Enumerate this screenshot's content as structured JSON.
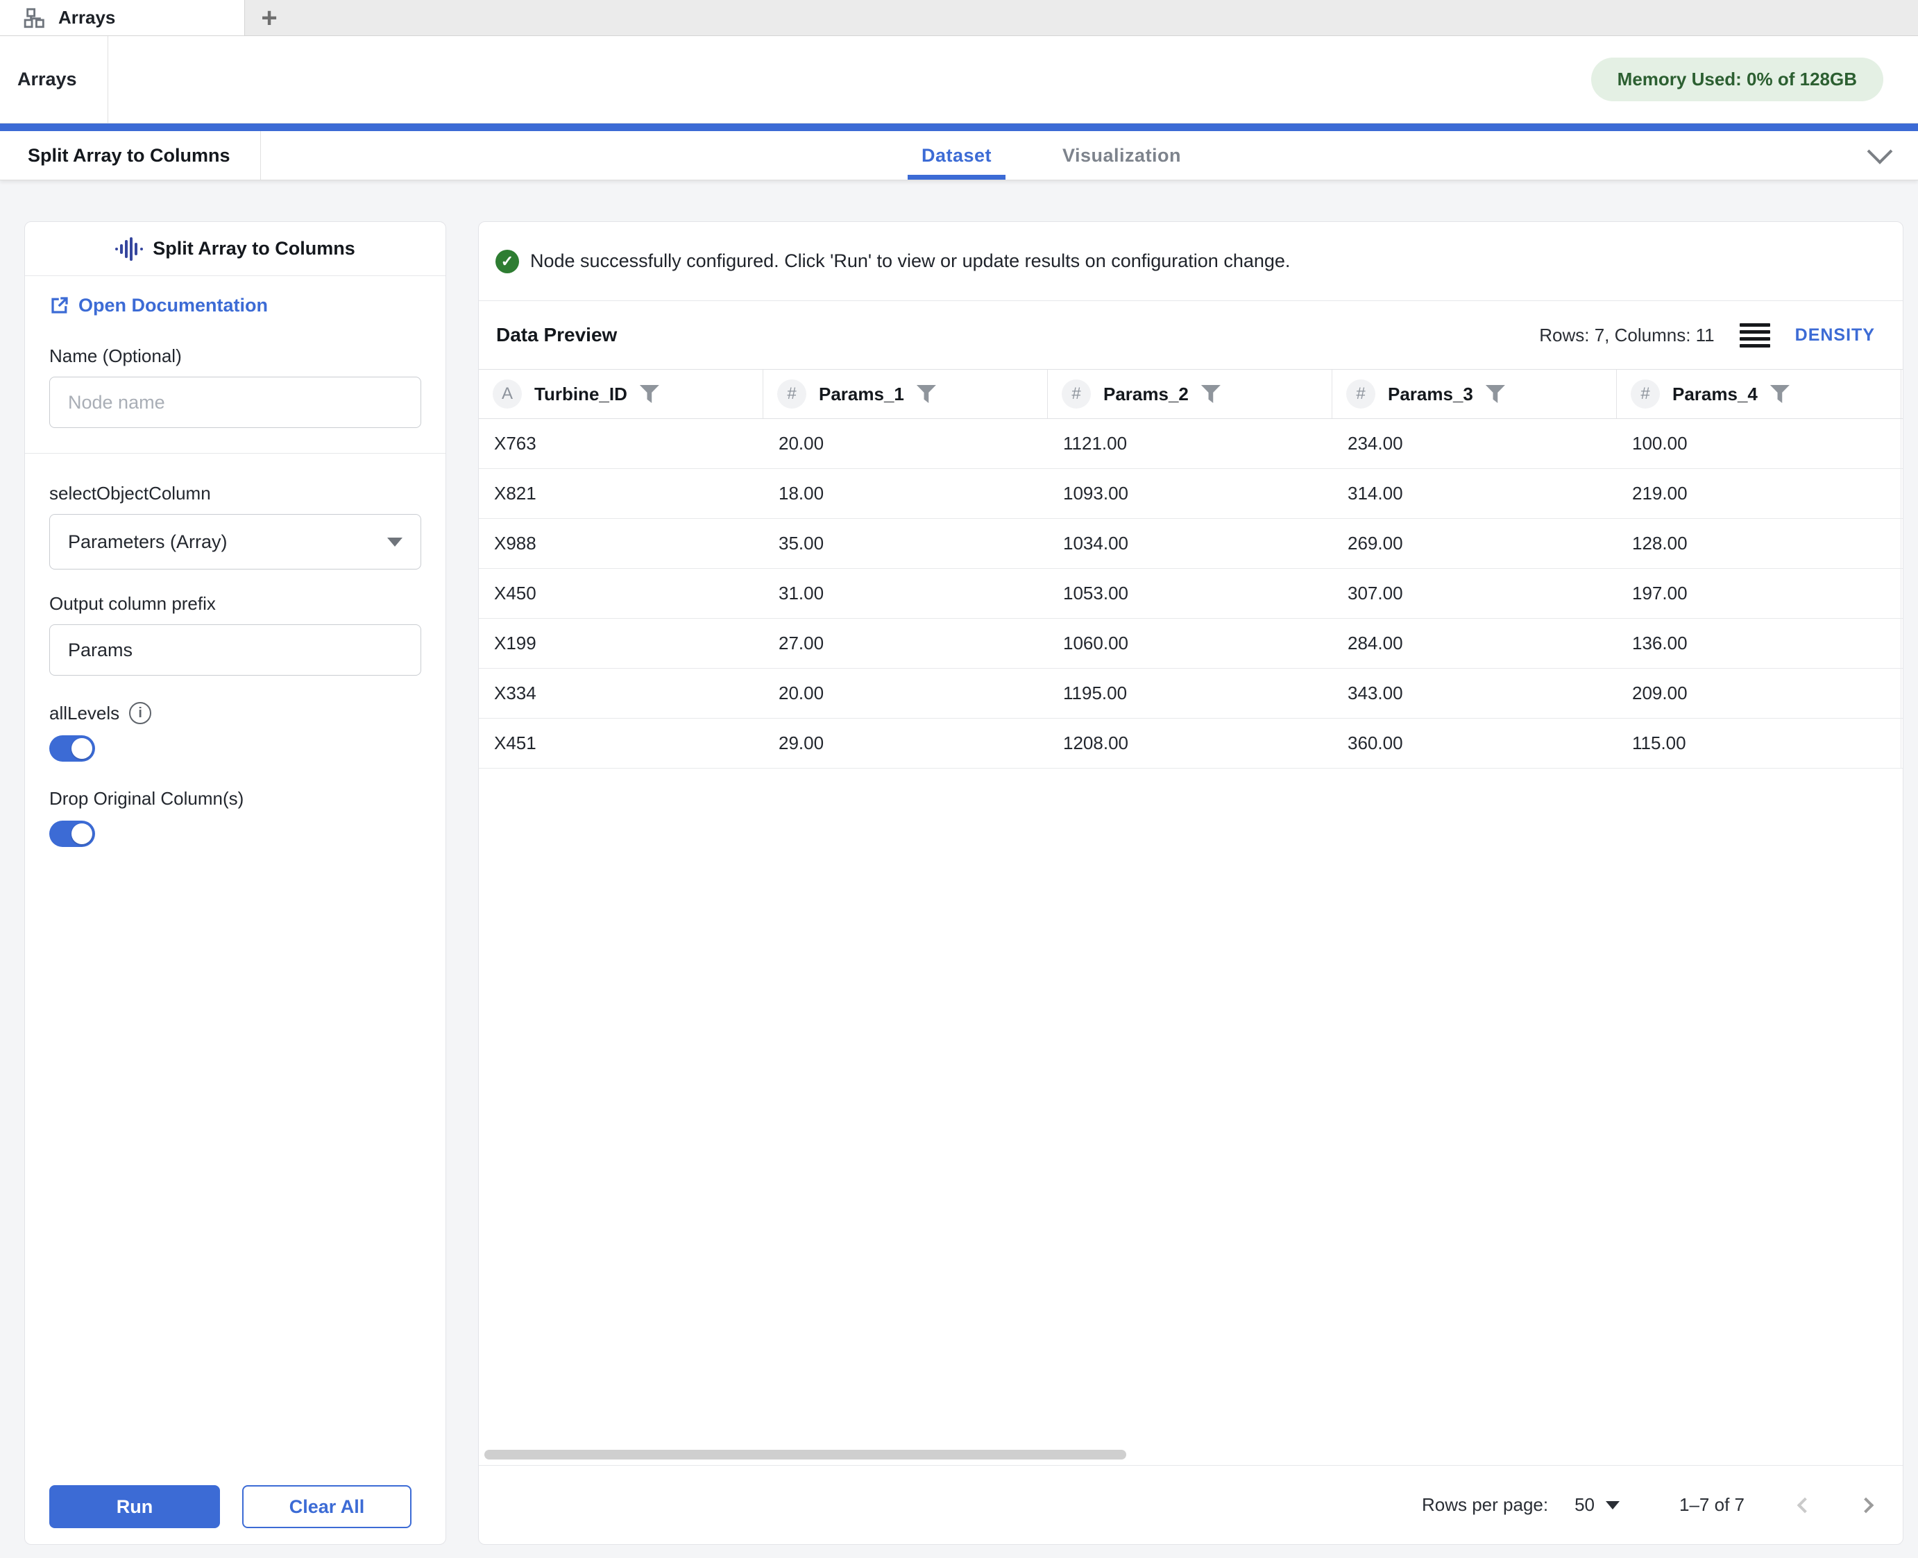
{
  "window": {
    "tab_label": "Arrays",
    "new_tab_label": "+"
  },
  "header": {
    "title": "Arrays",
    "memory_badge": "Memory Used: 0% of 128GB"
  },
  "subheader": {
    "node_title": "Split Array to Columns",
    "tabs": [
      {
        "label": "Dataset",
        "active": true
      },
      {
        "label": "Visualization",
        "active": false
      }
    ]
  },
  "config_panel": {
    "title": "Split Array to Columns",
    "doc_link_label": "Open Documentation",
    "name_label": "Name (Optional)",
    "name_placeholder": "Node name",
    "select_label": "selectObjectColumn",
    "select_value": "Parameters (Array)",
    "prefix_label": "Output column prefix",
    "prefix_value": "Params",
    "all_levels_label": "allLevels",
    "all_levels_on": true,
    "drop_original_label": "Drop Original Column(s)",
    "drop_original_on": true,
    "run_label": "Run",
    "clear_label": "Clear All"
  },
  "preview": {
    "status_message": "Node successfully configured. Click 'Run' to view or update results on configuration change.",
    "title": "Data Preview",
    "row_col_info": "Rows: 7, Columns: 11",
    "density_label": "DENSITY",
    "table": {
      "columns": [
        {
          "type": "A",
          "label": "Turbine_ID"
        },
        {
          "type": "#",
          "label": "Params_1"
        },
        {
          "type": "#",
          "label": "Params_2"
        },
        {
          "type": "#",
          "label": "Params_3"
        },
        {
          "type": "#",
          "label": "Params_4"
        }
      ],
      "rows": [
        [
          "X763",
          "20.00",
          "1121.00",
          "234.00",
          "100.00"
        ],
        [
          "X821",
          "18.00",
          "1093.00",
          "314.00",
          "219.00"
        ],
        [
          "X988",
          "35.00",
          "1034.00",
          "269.00",
          "128.00"
        ],
        [
          "X450",
          "31.00",
          "1053.00",
          "307.00",
          "197.00"
        ],
        [
          "X199",
          "27.00",
          "1060.00",
          "284.00",
          "136.00"
        ],
        [
          "X334",
          "20.00",
          "1195.00",
          "343.00",
          "209.00"
        ],
        [
          "X451",
          "29.00",
          "1208.00",
          "360.00",
          "115.00"
        ]
      ]
    },
    "pagination": {
      "rows_per_page_label": "Rows per page:",
      "rows_per_page_value": "50",
      "range_text": "1–7 of 7"
    }
  },
  "colors": {
    "accent_blue": "#3c6bd5",
    "badge_green_bg": "#e4f0e4",
    "badge_green_text": "#2c5f31",
    "success_green": "#2e7d32",
    "waveform_icon_blue": "#35469e"
  }
}
